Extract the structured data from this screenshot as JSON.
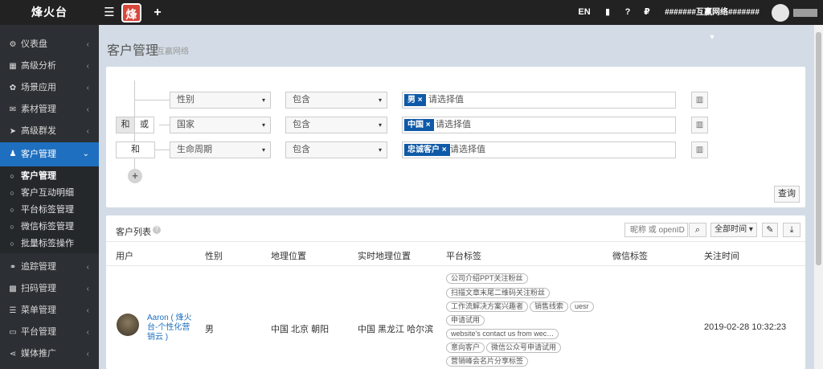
{
  "topbar": {
    "brand": "烽火台",
    "menu_icon": "menu-icon",
    "logo_char": "烽",
    "add_icon": "plus-icon",
    "lang": "EN",
    "book_icon": "book-icon",
    "help_icon": "question-icon",
    "currency_icon": "ruble-icon",
    "account": "#######互赢网络####### ▾"
  },
  "sidebar": {
    "items": [
      {
        "label": "仪表盘",
        "icon": "dashboard-icon",
        "glyph": "⚙"
      },
      {
        "label": "高级分析",
        "icon": "chart-icon",
        "glyph": "▦"
      },
      {
        "label": "场景应用",
        "icon": "gear-icon",
        "glyph": "✿"
      },
      {
        "label": "素材管理",
        "icon": "envelope-icon",
        "glyph": "✉"
      },
      {
        "label": "高级群发",
        "icon": "send-icon",
        "glyph": "➤"
      },
      {
        "label": "客户管理",
        "icon": "user-icon",
        "glyph": "♟"
      },
      {
        "label": "追踪管理",
        "icon": "link-icon",
        "glyph": "⚭"
      },
      {
        "label": "扫码管理",
        "icon": "qrcode-icon",
        "glyph": "▩"
      },
      {
        "label": "菜单管理",
        "icon": "list-icon",
        "glyph": "☰"
      },
      {
        "label": "平台管理",
        "icon": "monitor-icon",
        "glyph": "▭"
      },
      {
        "label": "媒体推广",
        "icon": "share-icon",
        "glyph": "⋖"
      }
    ],
    "subitems": [
      {
        "label": "客户管理"
      },
      {
        "label": "客户互动明细"
      },
      {
        "label": "平台标签管理"
      },
      {
        "label": "微信标签管理"
      },
      {
        "label": "批量标签操作"
      }
    ],
    "chevron_left": "‹",
    "chevron_down": "⌄"
  },
  "page": {
    "title": "客户管理",
    "subtitle": "互赢网络"
  },
  "filter": {
    "rows": [
      {
        "field": "性别",
        "op": "包含",
        "chip": "男 ×",
        "placeholder": "请选择值"
      },
      {
        "field": "国家",
        "op": "包含",
        "chip": "中国 ×",
        "placeholder": "请选择值"
      },
      {
        "field": "生命周期",
        "op": "包含",
        "chip": "忠诚客户 ×",
        "placeholder": "请选择值"
      }
    ],
    "and_label": "和",
    "or_label": "或",
    "and_label_3": "和",
    "trash_icon": "trash-icon",
    "caret": "▾",
    "add": "+",
    "query_button": "查询"
  },
  "list": {
    "title": "客户列表",
    "help": "?",
    "search_placeholder": "昵称 或 openID",
    "search_icon": "search-icon",
    "time_filter": "全部时间 ▾",
    "wrench_icon": "wrench-icon",
    "download_icon": "download-icon",
    "columns": [
      "用户",
      "性别",
      "地理位置",
      "实时地理位置",
      "平台标签",
      "微信标签",
      "关注时间"
    ],
    "row": {
      "user": "Aaron ( 烽火台-个性化营销云 )",
      "gender": "男",
      "geo": "中国 北京 朝阳",
      "realtime_geo": "中国 黑龙江 哈尔滨",
      "platform_tags": [
        "公司介绍PPT关注粉丝",
        "扫描文章末尾二维码关注粉丝",
        "工作流解决方案兴趣者",
        "销售线索",
        "uesr",
        "申请试用",
        "website's contact us from wec…",
        "意向客户",
        "微信公众号申请试用",
        "营销峰会名片分享标签"
      ],
      "follow_time": "2019-02-28 10:32:23"
    }
  }
}
